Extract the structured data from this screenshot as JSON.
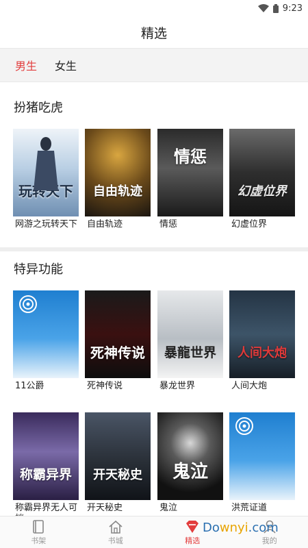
{
  "status": {
    "time": "9:23"
  },
  "header": {
    "title": "精选"
  },
  "tabs": [
    {
      "label": "男生",
      "active": true
    },
    {
      "label": "女生",
      "active": false
    }
  ],
  "sections": [
    {
      "title": "扮猪吃虎",
      "books": [
        {
          "name": "网游之玩转天下",
          "cover_text": "玩转天下"
        },
        {
          "name": "自由轨迹",
          "cover_text": "自由轨迹"
        },
        {
          "name": "情惩",
          "cover_text": "情惩"
        },
        {
          "name": "幻虚位界",
          "cover_text": "幻虚位界"
        }
      ]
    },
    {
      "title": "特异功能",
      "books": [
        {
          "name": "11公爵",
          "cover_text": ""
        },
        {
          "name": "死神传说",
          "cover_text": "死神传说"
        },
        {
          "name": "暴龙世界",
          "cover_text": "暴龍世界"
        },
        {
          "name": "人间大炮",
          "cover_text": "人间大炮"
        },
        {
          "name": "称霸异界无人可挡",
          "cover_text": "称霸异界"
        },
        {
          "name": "开天秘史",
          "cover_text": "开天秘史"
        },
        {
          "name": "鬼泣",
          "cover_text": "鬼泣"
        },
        {
          "name": "洪荒证道",
          "cover_text": ""
        }
      ]
    }
  ],
  "nav": [
    {
      "label": "书架",
      "icon": "bookshelf-icon"
    },
    {
      "label": "书城",
      "icon": "home-icon"
    },
    {
      "label": "精选",
      "icon": "featured-icon",
      "active": true
    },
    {
      "label": "我的",
      "icon": "user-icon"
    }
  ],
  "watermark": {
    "text_a": "Do",
    "text_b": "wnyi",
    "text_c": ".com"
  },
  "colors": {
    "accent": "#e23c3c"
  }
}
